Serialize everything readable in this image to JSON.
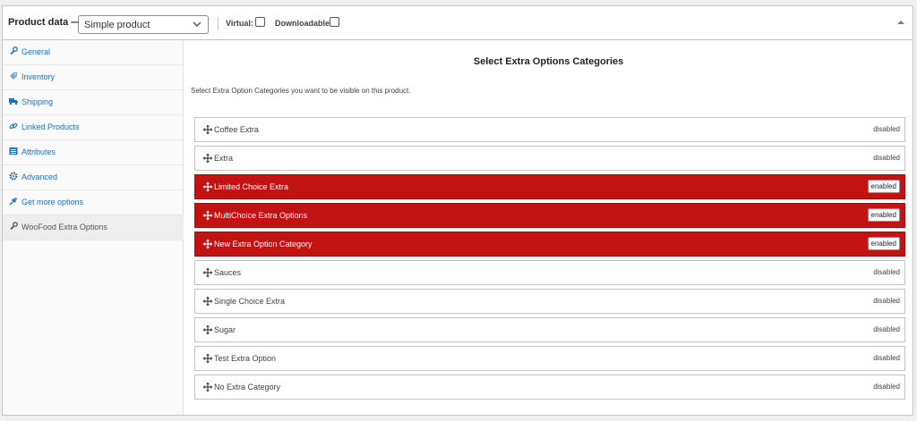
{
  "header": {
    "title": "Product data —",
    "product_type": "Simple product",
    "virtual_label": "Virtual:",
    "downloadable_label": "Downloadable:"
  },
  "sidebar": {
    "items": [
      {
        "label": "General",
        "icon": "wrench-icon"
      },
      {
        "label": "Inventory",
        "icon": "tag-icon"
      },
      {
        "label": "Shipping",
        "icon": "truck-icon"
      },
      {
        "label": "Linked Products",
        "icon": "link-icon"
      },
      {
        "label": "Attributes",
        "icon": "table-icon"
      },
      {
        "label": "Advanced",
        "icon": "gear-icon"
      },
      {
        "label": "Get more options",
        "icon": "plugin-icon"
      },
      {
        "label": "WooFood Extra Options",
        "icon": "wrench-icon"
      }
    ]
  },
  "main": {
    "heading": "Select Extra Options Categories",
    "description": "Select Extra Option Categories you want to be visible on this product.",
    "categories": [
      {
        "name": "Coffee Extra",
        "status": "disabled"
      },
      {
        "name": "Extra",
        "status": "disabled"
      },
      {
        "name": "Limited Choice Extra",
        "status": "enabled"
      },
      {
        "name": "MultiChoice Extra Options",
        "status": "enabled"
      },
      {
        "name": "New Extra Option Category",
        "status": "enabled"
      },
      {
        "name": "Sauces",
        "status": "disabled"
      },
      {
        "name": "Single Choice Extra",
        "status": "disabled"
      },
      {
        "name": "Sugar",
        "status": "disabled"
      },
      {
        "name": "Test Extra Option",
        "status": "disabled"
      },
      {
        "name": "No Extra Category",
        "status": "disabled"
      }
    ]
  },
  "colors": {
    "enabled_row": "#c31212",
    "link": "#2271b1"
  }
}
